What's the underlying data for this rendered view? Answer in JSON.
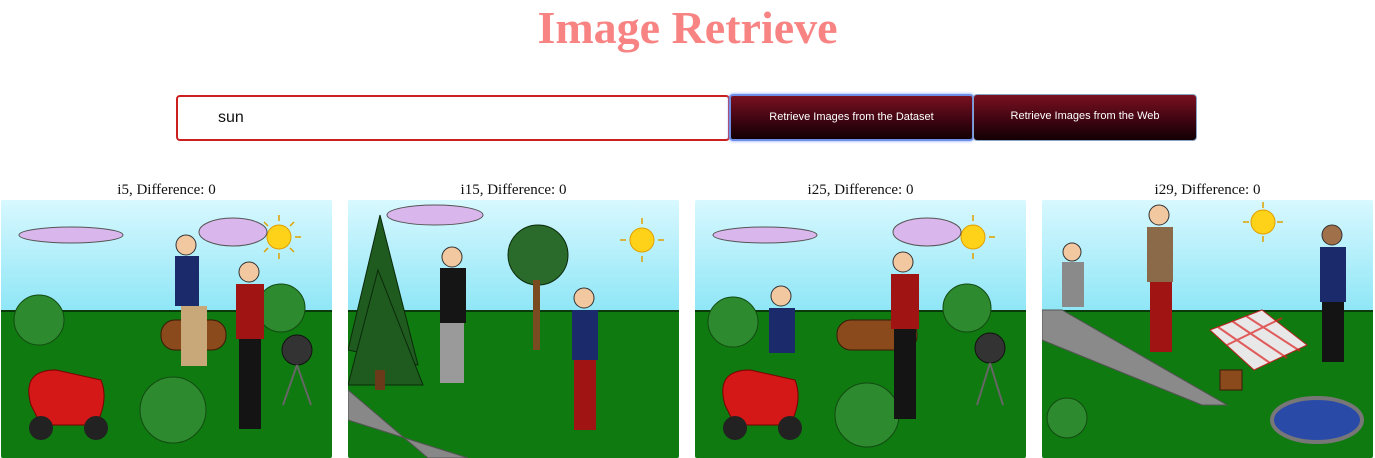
{
  "app": {
    "title": "Image Retrieve"
  },
  "search": {
    "value": "sun",
    "placeholder": ""
  },
  "buttons": {
    "dataset_label": "Retrieve Images from the Dataset",
    "web_label": "Retrieve Images from the Web"
  },
  "results": [
    {
      "label": "i5, Difference: 0"
    },
    {
      "label": "i15, Difference: 0"
    },
    {
      "label": "i25, Difference: 0"
    },
    {
      "label": "i29, Difference: 0"
    }
  ],
  "colors": {
    "title": "#f88383",
    "input_border": "#cc1f1f",
    "button_dark": "#3a0410",
    "button_focus_outline": "#6e8fe8",
    "sky": "#a8ecf8",
    "grass": "#0f7a0f",
    "sun": "#ffd21a"
  }
}
